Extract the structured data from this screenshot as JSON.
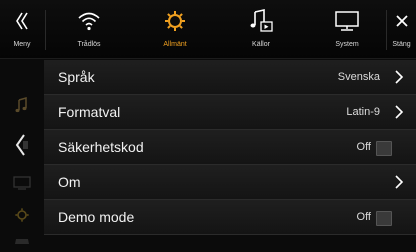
{
  "topbar": {
    "menu_label": "Meny",
    "tabs": [
      {
        "label": "Trådlös",
        "icon": "wifi-icon"
      },
      {
        "label": "Allmänt",
        "icon": "gear-icon"
      },
      {
        "label": "Källor",
        "icon": "music-source-icon"
      },
      {
        "label": "System",
        "icon": "monitor-icon"
      }
    ],
    "close_label": "Stäng",
    "active_color": "#f0a020"
  },
  "sidebar": {
    "icons": [
      "music-icon",
      "back-arrow-icon",
      "screen-icon",
      "gear-icon",
      "car-icon"
    ]
  },
  "settings": {
    "rows": [
      {
        "label": "Språk",
        "value": "Svenska",
        "control": "chevron"
      },
      {
        "label": "Formatval",
        "value": "Latin-9",
        "control": "chevron"
      },
      {
        "label": "Säkerhetskod",
        "value": "Off",
        "control": "toggle"
      },
      {
        "label": "Om",
        "value": "",
        "control": "chevron"
      },
      {
        "label": "Demo mode",
        "value": "Off",
        "control": "toggle"
      }
    ]
  }
}
